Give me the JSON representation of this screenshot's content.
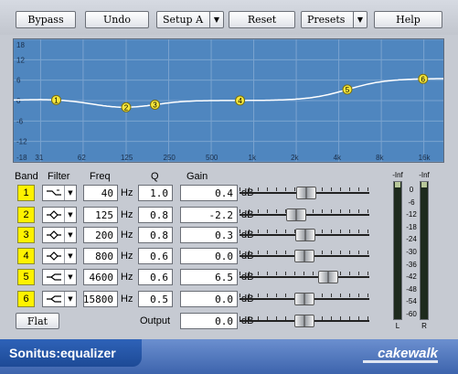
{
  "toolbar": {
    "bypass": "Bypass",
    "undo": "Undo",
    "setup": "Setup A",
    "reset": "Reset",
    "presets": "Presets",
    "help": "Help"
  },
  "graph": {
    "y_ticks": [
      "18",
      "12",
      "6",
      "0",
      "-6",
      "-12",
      "-18"
    ],
    "x_ticks": [
      "31",
      "62",
      "125",
      "250",
      "500",
      "1k",
      "2k",
      "4k",
      "8k",
      "16k"
    ],
    "background_color": "#4f86bf",
    "curve_color": "#ffffff",
    "node_color": "#f5e63a",
    "nodes": [
      {
        "label": "1",
        "freq": 40,
        "gain": 0.4
      },
      {
        "label": "2",
        "freq": 125,
        "gain": -2.2
      },
      {
        "label": "3",
        "freq": 200,
        "gain": 0.3
      },
      {
        "label": "4",
        "freq": 800,
        "gain": 0.0
      },
      {
        "label": "5",
        "freq": 4600,
        "gain": 6.5
      },
      {
        "label": "6",
        "freq": 15800,
        "gain": 0.0
      }
    ]
  },
  "headers": {
    "band": "Band",
    "filter": "Filter",
    "freq": "Freq",
    "q": "Q",
    "gain": "Gain"
  },
  "units": {
    "hz": "Hz",
    "db": "dB"
  },
  "bands": [
    {
      "band": "1",
      "filter_icon": "low-shelf-icon",
      "freq": "40",
      "q": "1.0",
      "gain": "0.4",
      "gain_value": 0.4
    },
    {
      "band": "2",
      "filter_icon": "peak-icon",
      "freq": "125",
      "q": "0.8",
      "gain": "-2.2",
      "gain_value": -2.2
    },
    {
      "band": "3",
      "filter_icon": "peak-icon",
      "freq": "200",
      "q": "0.8",
      "gain": "0.3",
      "gain_value": 0.3
    },
    {
      "band": "4",
      "filter_icon": "peak-icon",
      "freq": "800",
      "q": "0.6",
      "gain": "0.0",
      "gain_value": 0.0
    },
    {
      "band": "5",
      "filter_icon": "high-shelf-icon",
      "freq": "4600",
      "q": "0.6",
      "gain": "6.5",
      "gain_value": 6.5
    },
    {
      "band": "6",
      "filter_icon": "high-shelf-icon",
      "freq": "15800",
      "q": "0.5",
      "gain": "0.0",
      "gain_value": 0.0
    }
  ],
  "output": {
    "label": "Output",
    "gain": "0.0",
    "gain_value": 0.0
  },
  "flat_button": "Flat",
  "meters": {
    "left_top": "-Inf",
    "right_top": "-Inf",
    "scale": [
      "0",
      "-6",
      "-12",
      "-18",
      "-24",
      "-30",
      "-36",
      "-42",
      "-48",
      "-54",
      "-60"
    ],
    "left_label": "L",
    "right_label": "R"
  },
  "footer": {
    "title": "Sonitus:equalizer",
    "brand": "cakewalk"
  }
}
